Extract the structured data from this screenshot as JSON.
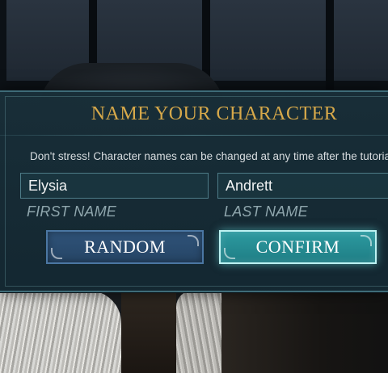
{
  "dialog": {
    "title": "NAME YOUR CHARACTER",
    "subtitle": "Don't stress! Character names can be changed at any time after the tutorial."
  },
  "fields": {
    "first_name": {
      "value": "Elysia",
      "label": "FIRST NAME"
    },
    "last_name": {
      "value": "Andrett",
      "label": "LAST NAME"
    }
  },
  "buttons": {
    "random_label": "RANDOM",
    "confirm_label": "CONFIRM"
  },
  "colors": {
    "title_gold": "#d6a84a",
    "panel_teal": "#182e38",
    "random_blue": "#2f5379",
    "confirm_teal": "#2c9aa0"
  }
}
